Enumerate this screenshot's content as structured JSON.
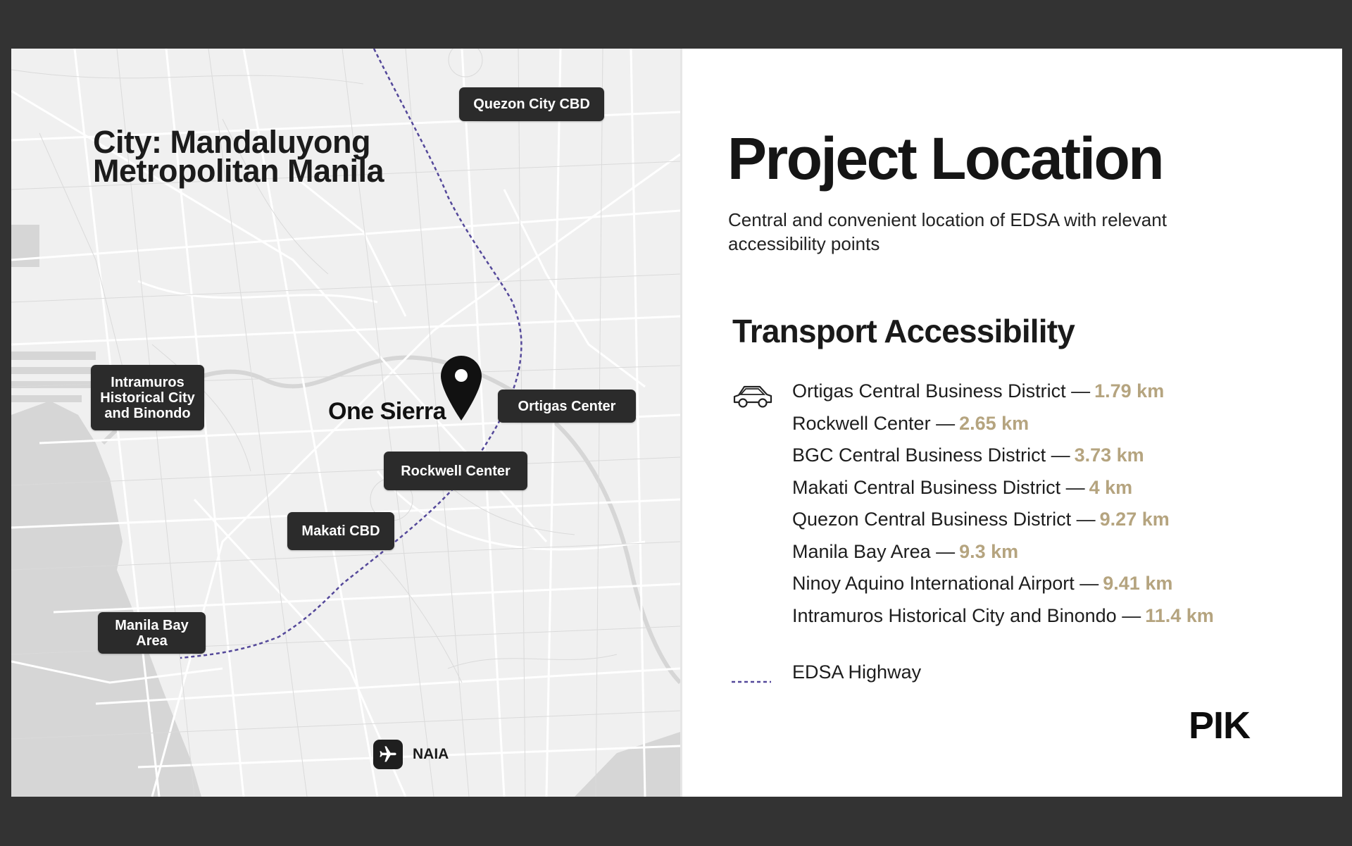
{
  "map": {
    "city_line1": "City: Mandaluyong",
    "city_line2": "Metropolitan Manila",
    "project_name": "One Sierra",
    "labels": {
      "quezon": "Quezon City CBD",
      "intramuros": [
        "Intramuros",
        "Historical City",
        "and Binondo"
      ],
      "ortigas": "Ortigas Center",
      "rockwell": "Rockwell Center",
      "makati": "Makati CBD",
      "manila_bay": [
        "Manila Bay",
        "Area"
      ]
    },
    "airport_label": "NAIA",
    "airport_icon": "airplane-icon",
    "pin_icon": "map-pin-icon",
    "colors": {
      "water": "#d6d6d6",
      "land": "#f0f0f0",
      "roads": "#ffffff",
      "edsa": "#54489a"
    }
  },
  "info": {
    "title": "Project Location",
    "subtitle": "Central and convenient location of EDSA with relevant accessibility points",
    "section_title": "Transport Accessibility",
    "transport_icon": "car-icon",
    "destinations": [
      {
        "name": "Ortigas Central Business District —",
        "distance": "1.79 km"
      },
      {
        "name": "Rockwell Center —",
        "distance": "2.65 km"
      },
      {
        "name": "BGC Central Business District —",
        "distance": "3.73 km"
      },
      {
        "name": "Makati Central Business District —",
        "distance": "4 km"
      },
      {
        "name": "Quezon Central Business District —",
        "distance": "9.27 km"
      },
      {
        "name": "Manila Bay Area —",
        "distance": "9.3 km"
      },
      {
        "name": "Ninoy Aquino International Airport —",
        "distance": "9.41 km"
      },
      {
        "name": "Intramuros Historical City and Binondo  —",
        "distance": "11.4 km"
      }
    ],
    "legend_label": "EDSA Highway",
    "logo": "PIK",
    "colors": {
      "distance": "#b5a47f",
      "text": "#1d1d1d"
    }
  }
}
